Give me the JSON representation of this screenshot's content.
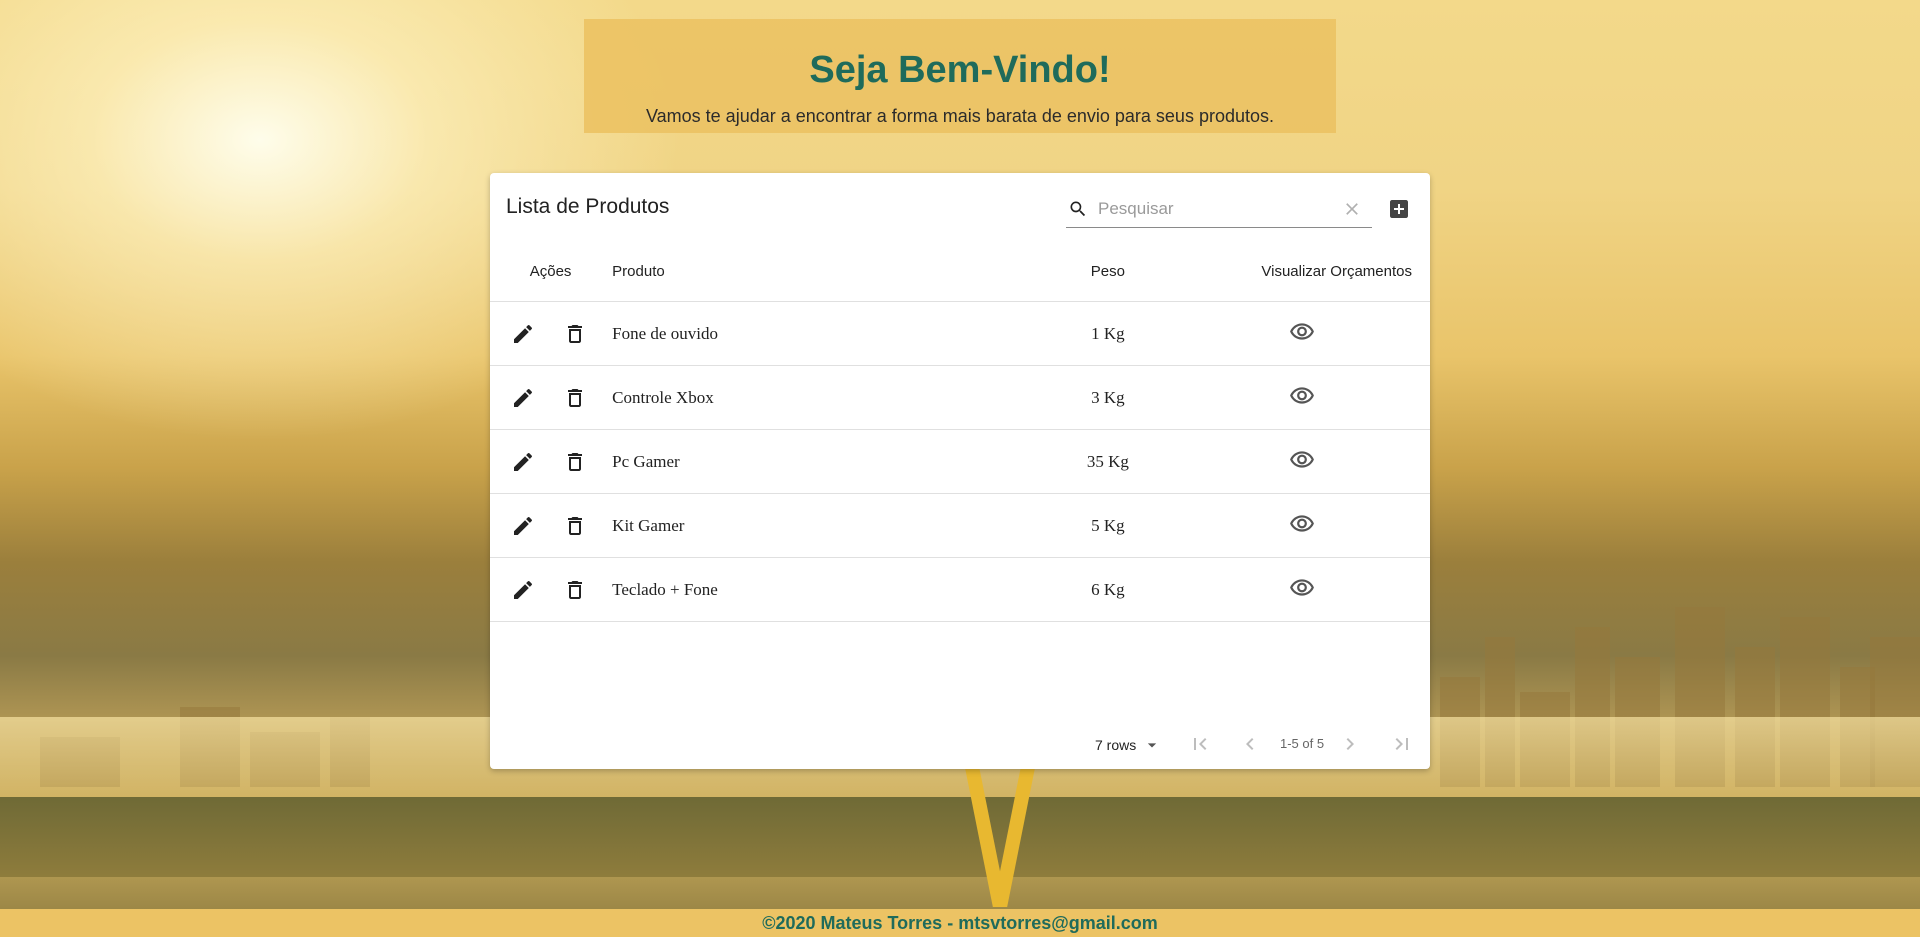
{
  "header": {
    "title": "Seja Bem-Vindo!",
    "subtitle": "Vamos te ajudar a encontrar a forma mais barata de envio para seus produtos."
  },
  "card": {
    "title": "Lista de Produtos",
    "search": {
      "placeholder": "Pesquisar",
      "value": ""
    },
    "columns": {
      "actions": "Ações",
      "product": "Produto",
      "weight": "Peso",
      "view": "Visualizar Orçamentos"
    },
    "rows": [
      {
        "product": "Fone de ouvido",
        "weight": "1 Kg"
      },
      {
        "product": "Controle Xbox",
        "weight": "3 Kg"
      },
      {
        "product": "Pc Gamer",
        "weight": "35 Kg"
      },
      {
        "product": "Kit Gamer",
        "weight": "5 Kg"
      },
      {
        "product": "Teclado + Fone",
        "weight": "6 Kg"
      }
    ],
    "pagination": {
      "rows_label": "7 rows",
      "range": "1-5 of 5"
    }
  },
  "icons": {
    "search": "search-icon",
    "clear": "close-icon",
    "add": "add-box-icon",
    "edit": "pencil-icon",
    "delete": "trash-icon",
    "view": "eye-icon"
  },
  "colors": {
    "accent": "#1f6b5b",
    "banner": "#ecc364",
    "icon": "#222222"
  },
  "footer": {
    "text": "©2020 Mateus Torres - mtsvtorres@gmail.com"
  }
}
